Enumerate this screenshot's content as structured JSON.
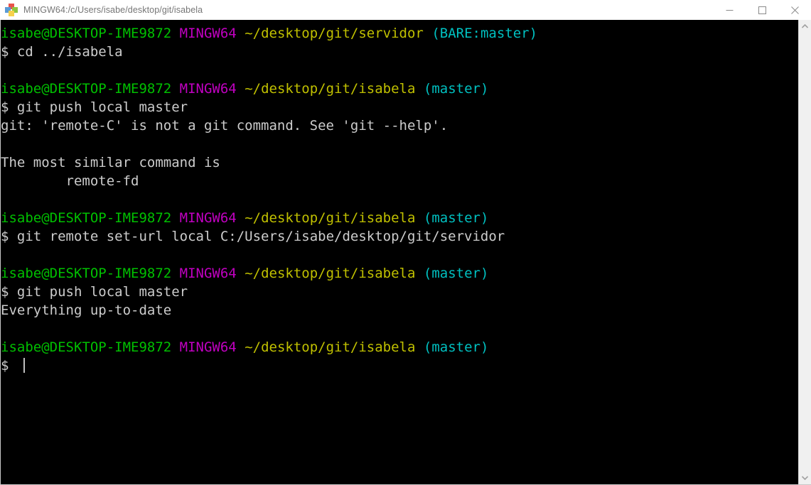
{
  "window": {
    "title": "MINGW64:/c/Users/isabe/desktop/git/isabela",
    "icon": "mingw-diamond-icon",
    "controls": {
      "minimize_label": "Minimize",
      "maximize_label": "Maximize",
      "close_label": "Close"
    }
  },
  "colors": {
    "background": "#000000",
    "foreground": "#cccccc",
    "green": "#00c000",
    "magenta": "#c000c0",
    "yellow": "#c0c000",
    "cyan": "#00c0c0",
    "titlebar_bg": "#ffffff",
    "titlebar_fg": "#767676",
    "scrollbar_bg": "#f0f0f0"
  },
  "terminal": {
    "prompt_user_host": "isabe@DESKTOP-IME9872",
    "prompt_shell": "MINGW64",
    "prompt_symbol": "$",
    "lines": [
      {
        "type": "prompt",
        "user_host": "isabe@DESKTOP-IME9872",
        "shell": "MINGW64",
        "path": "~/desktop/git/servidor",
        "branch": "(BARE:master)"
      },
      {
        "type": "command",
        "prompt": "$ ",
        "text": "cd ../isabela"
      },
      {
        "type": "blank",
        "text": ""
      },
      {
        "type": "prompt",
        "user_host": "isabe@DESKTOP-IME9872",
        "shell": "MINGW64",
        "path": "~/desktop/git/isabela",
        "branch": "(master)"
      },
      {
        "type": "command",
        "prompt": "$ ",
        "text": "git push local master"
      },
      {
        "type": "output",
        "text": "git: 'remote-C' is not a git command. See 'git --help'."
      },
      {
        "type": "blank",
        "text": ""
      },
      {
        "type": "output",
        "text": "The most similar command is"
      },
      {
        "type": "output",
        "text": "        remote-fd"
      },
      {
        "type": "blank",
        "text": ""
      },
      {
        "type": "prompt",
        "user_host": "isabe@DESKTOP-IME9872",
        "shell": "MINGW64",
        "path": "~/desktop/git/isabela",
        "branch": "(master)"
      },
      {
        "type": "command",
        "prompt": "$ ",
        "text": "git remote set-url local C:/Users/isabe/desktop/git/servidor"
      },
      {
        "type": "blank",
        "text": ""
      },
      {
        "type": "prompt",
        "user_host": "isabe@DESKTOP-IME9872",
        "shell": "MINGW64",
        "path": "~/desktop/git/isabela",
        "branch": "(master)"
      },
      {
        "type": "command",
        "prompt": "$ ",
        "text": "git push local master"
      },
      {
        "type": "output",
        "text": "Everything up-to-date"
      },
      {
        "type": "blank",
        "text": ""
      },
      {
        "type": "prompt",
        "user_host": "isabe@DESKTOP-IME9872",
        "shell": "MINGW64",
        "path": "~/desktop/git/isabela",
        "branch": "(master)"
      },
      {
        "type": "cursor_line",
        "prompt": "$ ",
        "text": ""
      }
    ]
  },
  "scrollbar": {
    "up_arrow": "chevron-up-icon",
    "down_arrow": "chevron-down-icon",
    "thumb_position": "full"
  }
}
